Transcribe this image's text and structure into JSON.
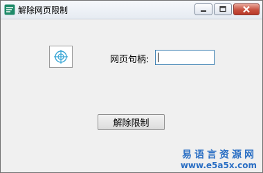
{
  "window": {
    "title": "解除网页限制",
    "app_icon": "app-icon",
    "caption_buttons": [
      "minimize-icon",
      "maximize-icon",
      "close-icon"
    ]
  },
  "main": {
    "finder_icon": "crosshair-icon",
    "handle_label": "网页句柄:",
    "handle_value": "",
    "unlock_button_label": "解除限制"
  },
  "watermark": {
    "line1": "易语言资源网",
    "line2": "www.e5a5x.com"
  },
  "colors": {
    "accent": "#2b6fc4",
    "input_border": "#3c7fb1",
    "close_button": "#c7503f",
    "crosshair": "#3aa7d6"
  }
}
